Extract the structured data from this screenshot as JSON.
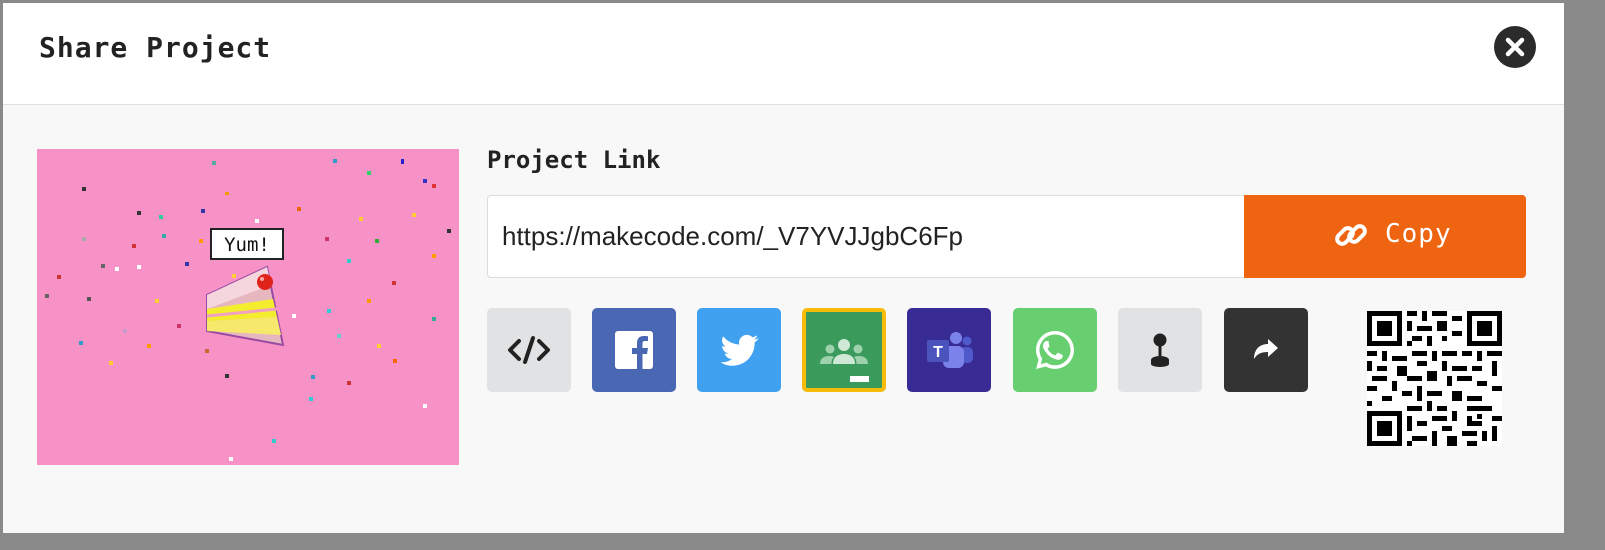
{
  "dialog": {
    "title": "Share Project",
    "close_icon": "close-icon"
  },
  "thumbnail": {
    "speech_text": "Yum!",
    "background_color": "#f792c6"
  },
  "link_section": {
    "label": "Project Link",
    "url": "https://makecode.com/_V7YVJJgbC6Fp",
    "copy_label": "Copy",
    "copy_icon": "link-icon",
    "copy_color": "#ee6410"
  },
  "share_buttons": [
    {
      "name": "embed",
      "icon": "code-icon",
      "color": "#e1e2e3"
    },
    {
      "name": "facebook",
      "icon": "facebook-icon",
      "color": "#4a67b4"
    },
    {
      "name": "twitter",
      "icon": "twitter-icon",
      "color": "#40a1f0"
    },
    {
      "name": "google-classroom",
      "icon": "google-classroom-icon",
      "color": "#3a9b5d"
    },
    {
      "name": "microsoft-teams",
      "icon": "microsoft-teams-icon",
      "color": "#382b94"
    },
    {
      "name": "whatsapp",
      "icon": "whatsapp-icon",
      "color": "#67cf70"
    },
    {
      "name": "arcade",
      "icon": "joystick-icon",
      "color": "#e1e2e3"
    },
    {
      "name": "share-more",
      "icon": "share-arrow-icon",
      "color": "#333333"
    }
  ],
  "qr_code": {
    "icon": "qr-code-icon"
  }
}
